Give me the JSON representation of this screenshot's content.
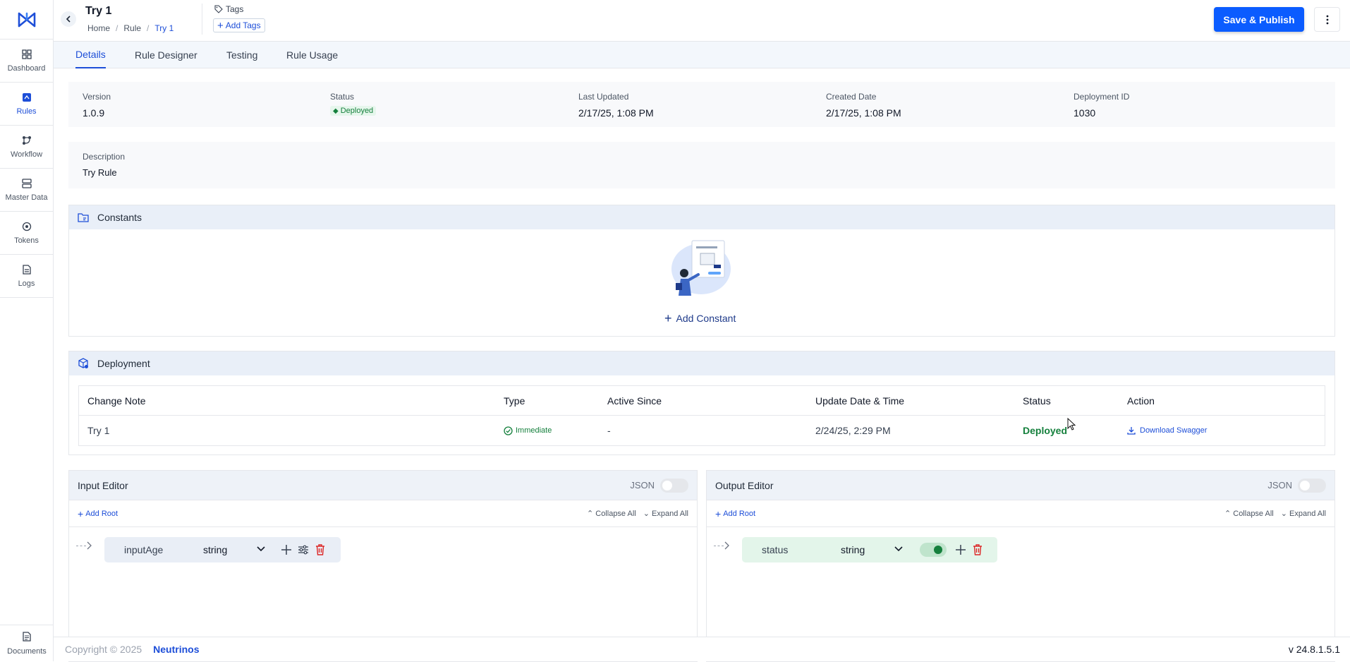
{
  "sidebar": {
    "items": [
      {
        "label": "Dashboard",
        "icon": "dashboard-icon"
      },
      {
        "label": "Rules",
        "icon": "rules-icon"
      },
      {
        "label": "Workflow",
        "icon": "workflow-icon"
      },
      {
        "label": "Master Data",
        "icon": "master-data-icon"
      },
      {
        "label": "Tokens",
        "icon": "tokens-icon"
      },
      {
        "label": "Logs",
        "icon": "logs-icon"
      }
    ],
    "active": "Rules",
    "documents_label": "Documents"
  },
  "header": {
    "title": "Try 1",
    "breadcrumb": [
      "Home",
      "Rule",
      "Try 1"
    ],
    "tags_label": "Tags",
    "add_tags_label": "Add Tags",
    "save_publish_label": "Save & Publish"
  },
  "tabs": [
    {
      "label": "Details",
      "active": true
    },
    {
      "label": "Rule Designer",
      "active": false
    },
    {
      "label": "Testing",
      "active": false
    },
    {
      "label": "Rule Usage",
      "active": false
    }
  ],
  "info": {
    "version_label": "Version",
    "version": "1.0.9",
    "status_label": "Status",
    "status": "Deployed",
    "last_updated_label": "Last Updated",
    "last_updated": "2/17/25, 1:08 PM",
    "created_label": "Created Date",
    "created": "2/17/25, 1:08 PM",
    "deployment_id_label": "Deployment ID",
    "deployment_id": "1030"
  },
  "description": {
    "label": "Description",
    "value": "Try Rule"
  },
  "constants": {
    "title": "Constants",
    "add_label": "Add Constant"
  },
  "deployment": {
    "title": "Deployment",
    "columns": [
      "Change Note",
      "Type",
      "Active Since",
      "Update Date & Time",
      "Status",
      "Action"
    ],
    "rows": [
      {
        "change_note": "Try 1",
        "type": "Immediate",
        "active_since": "-",
        "updated": "2/24/25, 2:29 PM",
        "status": "Deployed",
        "action": "Download Swagger"
      }
    ]
  },
  "input_editor": {
    "title": "Input Editor",
    "json_label": "JSON",
    "add_root": "Add Root",
    "collapse_all": "Collapse All",
    "expand_all": "Expand All",
    "node": {
      "name": "inputAge",
      "type": "string"
    }
  },
  "output_editor": {
    "title": "Output Editor",
    "json_label": "JSON",
    "add_root": "Add Root",
    "collapse_all": "Collapse All",
    "expand_all": "Expand All",
    "node": {
      "name": "status",
      "type": "string"
    }
  },
  "footer": {
    "copyright": "Copyright © 2025",
    "brand": "Neutrinos",
    "version": "v 24.8.1.5.1"
  },
  "colors": {
    "primary": "#0b5cff",
    "success": "#15803d",
    "link": "#1d4ed8",
    "danger": "#dc2626"
  }
}
